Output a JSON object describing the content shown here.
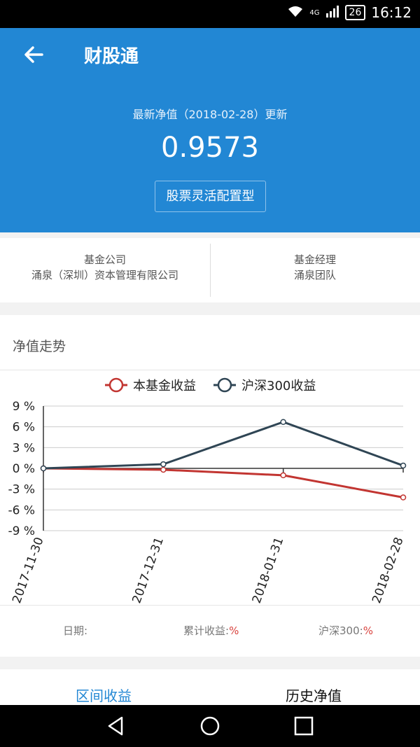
{
  "status_bar": {
    "network": "4G",
    "battery": "26",
    "time": "16:12"
  },
  "app_bar": {
    "title": "财股通"
  },
  "hero": {
    "subtitle": "最新净值（2018-02-28）更新",
    "nav_value": "0.9573",
    "fund_type": "股票灵活配置型"
  },
  "info": {
    "company_label": "基金公司",
    "company_value": "涌泉（深圳）资本管理有限公司",
    "manager_label": "基金经理",
    "manager_value": "涌泉团队"
  },
  "trend": {
    "heading": "净值走势",
    "footer": {
      "date_label": "日期:",
      "cum_label": "累计收益:",
      "cum_unit": "%",
      "hs_label": "沪深300:",
      "hs_unit": "%"
    }
  },
  "chart_data": {
    "type": "line",
    "x": [
      "2017-11-30",
      "2017-12-31",
      "2018-01-31",
      "2018-02-28"
    ],
    "series": [
      {
        "name": "本基金收益",
        "values": [
          0,
          -0.2,
          -1.0,
          -4.2
        ],
        "color": "#c23531"
      },
      {
        "name": "沪深300收益",
        "values": [
          0,
          0.6,
          6.7,
          0.4
        ],
        "color": "#2f4554"
      }
    ],
    "y_ticks": [
      "9 %",
      "6 %",
      "3 %",
      "0 %",
      "-3 %",
      "-6 %",
      "-9 %"
    ],
    "ylim": [
      -9,
      9
    ],
    "grid": true,
    "legend": "top-center"
  },
  "tabs": {
    "active": "区间收益",
    "other": "历史净值"
  }
}
